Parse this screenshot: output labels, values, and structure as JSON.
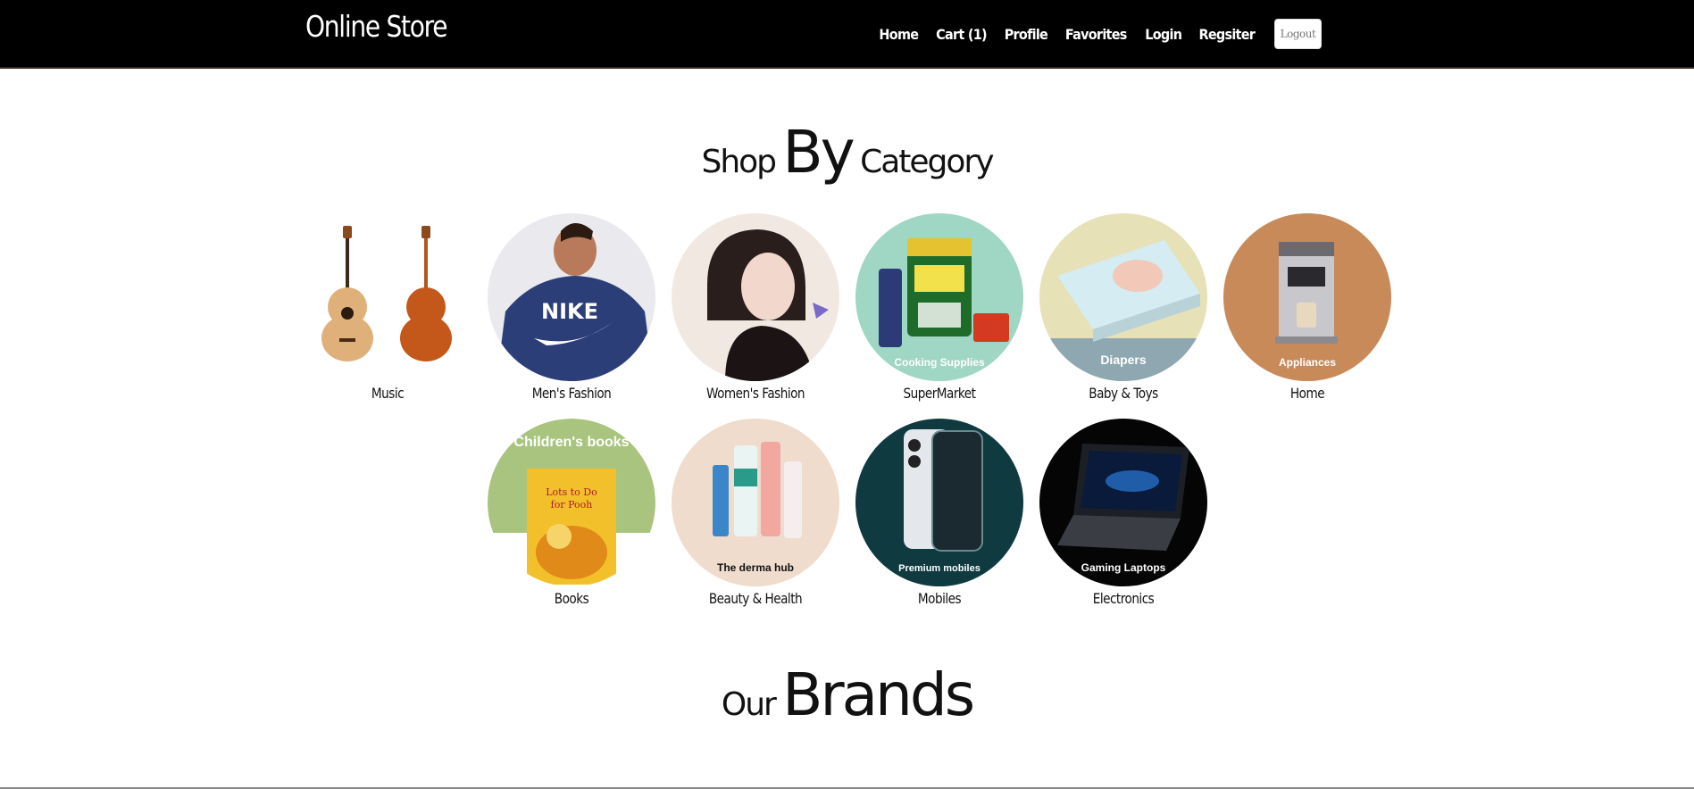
{
  "nav": {
    "brand": "Online Store",
    "links": [
      "Home",
      "Cart (1)",
      "Profile",
      "Favorites",
      "Login",
      "Regsiter"
    ],
    "logout_label": "Logout"
  },
  "shop_title": {
    "part1": "Shop",
    "part2": "By",
    "part3": "Category"
  },
  "brands_title": {
    "part1": "Our",
    "part2": "Brands"
  },
  "categories": [
    {
      "name": "Music",
      "overlay": ""
    },
    {
      "name": "Men's Fashion",
      "overlay": ""
    },
    {
      "name": "Women's Fashion",
      "overlay": ""
    },
    {
      "name": "SuperMarket",
      "overlay": "Cooking Supplies"
    },
    {
      "name": "Baby & Toys",
      "overlay": "Diapers"
    },
    {
      "name": "Home",
      "overlay": "Appliances"
    },
    {
      "name": "Books",
      "overlay": "Children's books"
    },
    {
      "name": "Beauty & Health",
      "overlay": "The derma hub"
    },
    {
      "name": "Mobiles",
      "overlay": "Premium mobiles"
    },
    {
      "name": "Electronics",
      "overlay": "Gaming Laptops"
    }
  ],
  "book_cover": "Lots to Do for Pooh",
  "colors": {
    "navbar_bg": "#000000",
    "supermarket_bg": "#9fd6c4",
    "appliances_bg": "#c98a5a",
    "books_bg": "#a9c47e",
    "beauty_bg": "#efdccd",
    "mobiles_bg": "#0e3a40",
    "electronics_bg": "#050505"
  }
}
